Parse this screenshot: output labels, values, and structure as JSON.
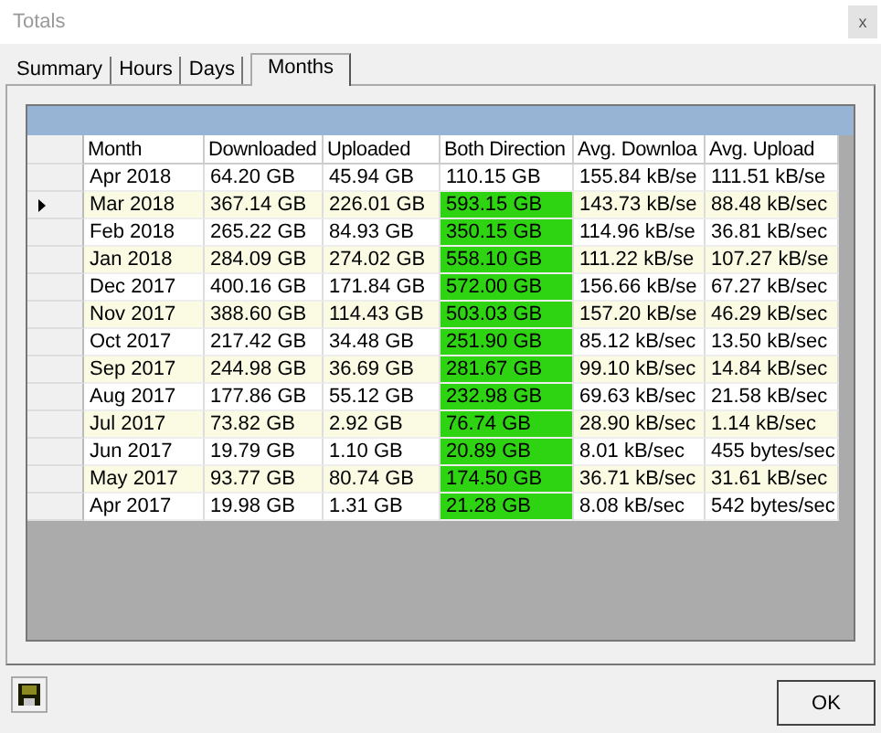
{
  "window": {
    "title": "Totals",
    "close": "x"
  },
  "tabs": [
    {
      "label": "Summary",
      "selected": false
    },
    {
      "label": "Hours",
      "selected": false
    },
    {
      "label": "Days",
      "selected": false
    },
    {
      "label": "Months",
      "selected": true
    }
  ],
  "table": {
    "columns": [
      "Month",
      "Downloaded",
      "Uploaded",
      "Both Direction",
      "Avg. Downloa",
      "Avg. Upload"
    ],
    "rows": [
      {
        "selected": false,
        "highlighted": false,
        "cells": [
          "Apr 2018",
          "64.20 GB",
          "45.94 GB",
          "110.15 GB",
          "155.84 kB/se",
          "111.51 kB/se"
        ]
      },
      {
        "selected": true,
        "highlighted": true,
        "cells": [
          "Mar 2018",
          "367.14 GB",
          "226.01 GB",
          "593.15 GB",
          "143.73 kB/se",
          "88.48 kB/sec"
        ]
      },
      {
        "selected": false,
        "highlighted": true,
        "cells": [
          "Feb 2018",
          "265.22 GB",
          "84.93 GB",
          "350.15 GB",
          "114.96 kB/se",
          "36.81 kB/sec"
        ]
      },
      {
        "selected": false,
        "highlighted": true,
        "cells": [
          "Jan 2018",
          "284.09 GB",
          "274.02 GB",
          "558.10 GB",
          "111.22 kB/se",
          "107.27 kB/se"
        ]
      },
      {
        "selected": false,
        "highlighted": true,
        "cells": [
          "Dec 2017",
          "400.16 GB",
          "171.84 GB",
          "572.00 GB",
          "156.66 kB/se",
          "67.27 kB/sec"
        ]
      },
      {
        "selected": false,
        "highlighted": true,
        "cells": [
          "Nov 2017",
          "388.60 GB",
          "114.43 GB",
          "503.03 GB",
          "157.20 kB/se",
          "46.29 kB/sec"
        ]
      },
      {
        "selected": false,
        "highlighted": true,
        "cells": [
          "Oct 2017",
          "217.42 GB",
          "34.48 GB",
          "251.90 GB",
          "85.12 kB/sec",
          "13.50 kB/sec"
        ]
      },
      {
        "selected": false,
        "highlighted": true,
        "cells": [
          "Sep 2017",
          "244.98 GB",
          "36.69 GB",
          "281.67 GB",
          "99.10 kB/sec",
          "14.84 kB/sec"
        ]
      },
      {
        "selected": false,
        "highlighted": true,
        "cells": [
          "Aug 2017",
          "177.86 GB",
          "55.12 GB",
          "232.98 GB",
          "69.63 kB/sec",
          "21.58 kB/sec"
        ]
      },
      {
        "selected": false,
        "highlighted": true,
        "cells": [
          "Jul 2017",
          "73.82 GB",
          "2.92 GB",
          "76.74 GB",
          "28.90 kB/sec",
          "1.14 kB/sec"
        ]
      },
      {
        "selected": false,
        "highlighted": true,
        "cells": [
          "Jun 2017",
          "19.79 GB",
          "1.10 GB",
          "20.89 GB",
          "8.01 kB/sec",
          "455 bytes/sec"
        ]
      },
      {
        "selected": false,
        "highlighted": true,
        "cells": [
          "May 2017",
          "93.77 GB",
          "80.74 GB",
          "174.50 GB",
          "36.71 kB/sec",
          "31.61 kB/sec"
        ]
      },
      {
        "selected": false,
        "highlighted": true,
        "cells": [
          "Apr 2017",
          "19.98 GB",
          "1.31 GB",
          "21.28 GB",
          "8.08 kB/sec",
          "542 bytes/sec"
        ]
      }
    ]
  },
  "buttons": {
    "ok": "OK"
  }
}
